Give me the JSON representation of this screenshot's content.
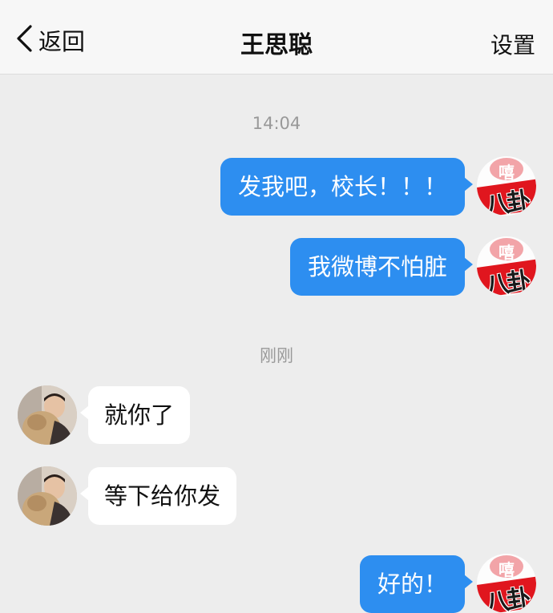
{
  "header": {
    "back_label": "返回",
    "title": "王思聪",
    "settings_label": "设置"
  },
  "timestamps": [
    "14:04",
    "刚刚"
  ],
  "my_avatar": {
    "top_char": "嘻",
    "banner_text": "八卦"
  },
  "messages": [
    {
      "side": "me",
      "text": "发我吧，校长！！！"
    },
    {
      "side": "me",
      "text": "我微博不怕脏"
    },
    {
      "side": "other",
      "text": "就你了"
    },
    {
      "side": "other",
      "text": "等下给你发"
    },
    {
      "side": "me",
      "text": "好的！"
    }
  ],
  "colors": {
    "my_bubble": "#2d8ef0",
    "other_bubble": "#ffffff",
    "background": "#ededed",
    "avatar_banner": "#e0161e"
  }
}
